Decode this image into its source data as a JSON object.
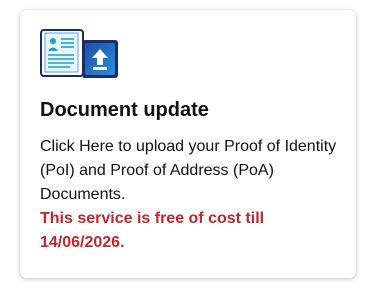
{
  "card": {
    "icon_name": "document-upload-icon",
    "title": "Document update",
    "description": "Click Here to upload your Proof of Identity (PoI) and Proof of Address (PoA) Documents.",
    "notice": "This service is free of cost till 14/06/2026."
  },
  "colors": {
    "notice": "#c0272d",
    "icon_navy": "#1d2a6b",
    "icon_blue": "#2a7fd4"
  }
}
